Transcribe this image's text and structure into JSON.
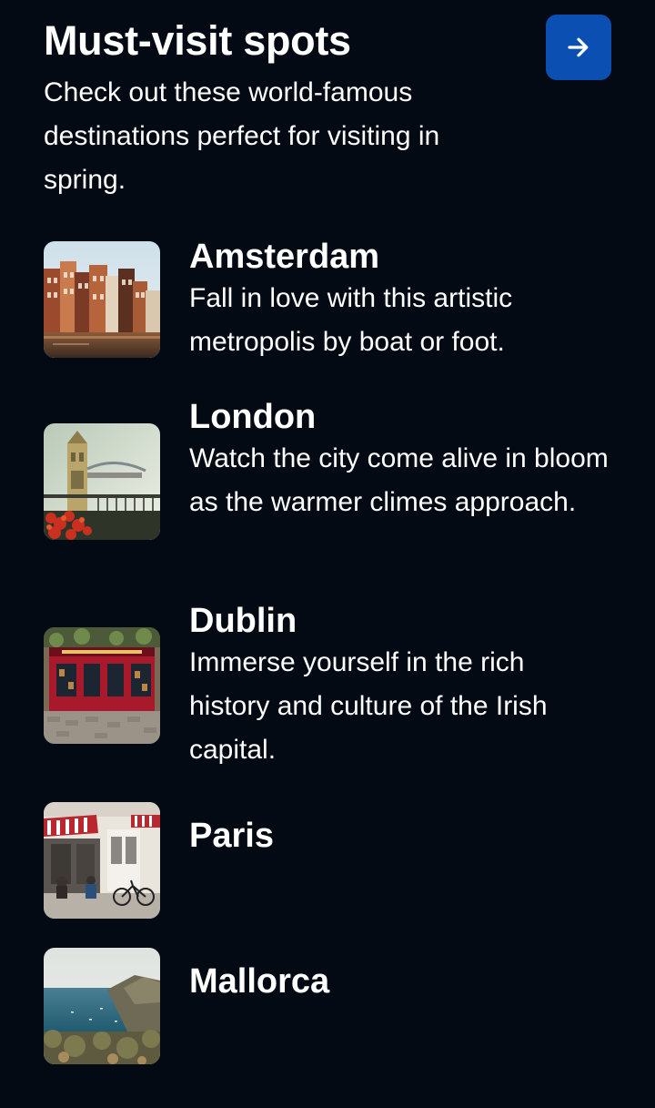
{
  "header": {
    "title": "Must-visit spots",
    "subtitle": "Check out these world-famous destinations perfect for visiting in spring.",
    "next_button_icon": "arrow-right-icon"
  },
  "colors": {
    "background": "#030a14",
    "accent": "#0b4fb3",
    "text": "#ffffff"
  },
  "destinations": [
    {
      "name": "Amsterdam",
      "description": "Fall in love with this artistic metropolis by boat or foot."
    },
    {
      "name": "London",
      "description": "Watch the city come alive in bloom as the warmer climes approach."
    },
    {
      "name": "Dublin",
      "description": "Immerse yourself in the rich history and culture of the Irish capital."
    },
    {
      "name": "Paris",
      "description": ""
    },
    {
      "name": "Mallorca",
      "description": ""
    }
  ]
}
